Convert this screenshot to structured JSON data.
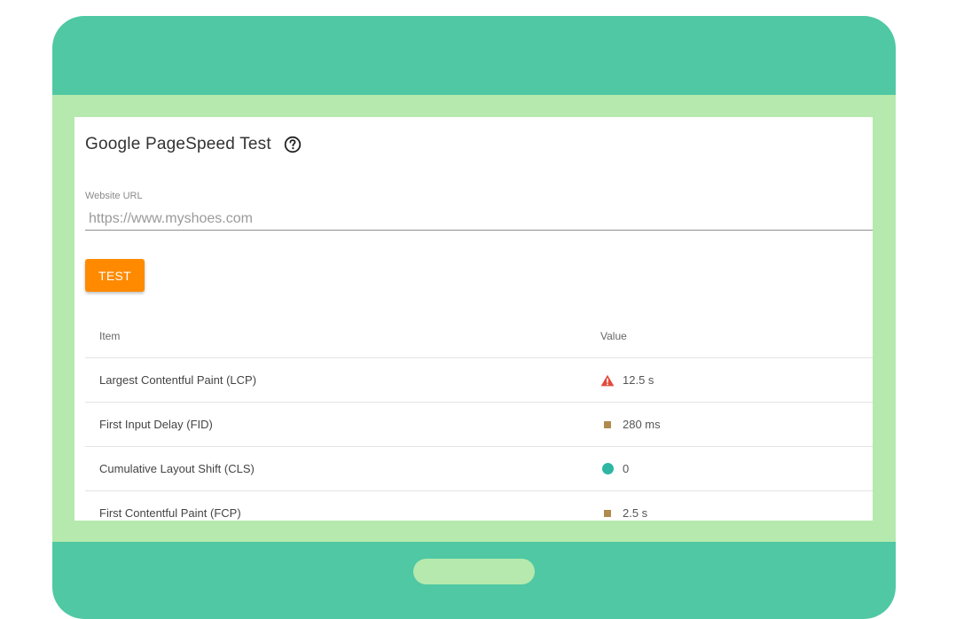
{
  "app": {
    "title": "Google PageSpeed Test",
    "help_icon": "question-circle-icon"
  },
  "form": {
    "url_label": "Website URL",
    "url_placeholder": "https://www.myshoes.com",
    "url_value": "",
    "test_button_label": "TEST"
  },
  "table": {
    "headers": {
      "item": "Item",
      "value": "Value"
    },
    "rows": [
      {
        "item": "Largest Contentful Paint (LCP)",
        "value": "12.5 s",
        "status": "poor",
        "icon": "warning-triangle-icon",
        "color": "#e24b3b"
      },
      {
        "item": "First Input Delay (FID)",
        "value": "280 ms",
        "status": "needs-improvement",
        "icon": "square-icon",
        "color": "#b08a4e"
      },
      {
        "item": "Cumulative Layout Shift (CLS)",
        "value": "0",
        "status": "good",
        "icon": "circle-icon",
        "color": "#2fb5a4"
      },
      {
        "item": "First Contentful Paint (FCP)",
        "value": "2.5 s",
        "status": "needs-improvement",
        "icon": "square-icon",
        "color": "#b08a4e"
      }
    ]
  },
  "colors": {
    "device": "#4fc8a3",
    "frame": "#b5e9ad",
    "accent_button": "#ff8a00"
  }
}
